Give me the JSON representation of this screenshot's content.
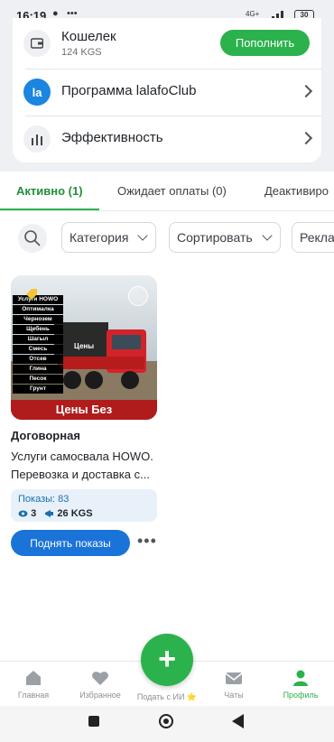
{
  "status_bar": {
    "time": "16:19",
    "network": "4G+",
    "battery": "30"
  },
  "menu": {
    "wallet": {
      "title": "Кошелек",
      "balance": "124 KGS",
      "topup_label": "Пополнить"
    },
    "club": {
      "title": "Программа lalafoClub"
    },
    "efficiency": {
      "title": "Эффективность"
    }
  },
  "tabs": [
    {
      "label": "Активно (1)",
      "active": true
    },
    {
      "label": "Ожидает оплаты (0)",
      "active": false
    },
    {
      "label": "Деактивиро",
      "active": false
    }
  ],
  "filters": {
    "category": "Категория",
    "sort": "Сортировать",
    "ads": "Рекла"
  },
  "listing": {
    "image_text": {
      "services": [
        "Услуги HOWO",
        "Оптималка",
        "Чернозем",
        "Щебень",
        "Шагыл",
        "Смесь",
        "Отсев",
        "Глина",
        "Песок",
        "Грунт"
      ],
      "truck_label": "Цены",
      "banner": "Цены Без посредников!!!"
    },
    "price": "Договорная",
    "title": "Услуги самосвала HOWO. Перевозка и доставка с...",
    "views_label": "Показы: 83",
    "views_count": "3",
    "boost_cost": "26 KGS",
    "boost_button": "Поднять показы"
  },
  "bottom_nav": [
    {
      "label": "Главная",
      "icon": "home-icon"
    },
    {
      "label": "Избранное",
      "icon": "heart-icon"
    },
    {
      "label": "Подать с ИИ ⭐",
      "icon": "plus-icon"
    },
    {
      "label": "Чаты",
      "icon": "mail-icon"
    },
    {
      "label": "Профиль",
      "icon": "user-icon",
      "active": true
    }
  ],
  "colors": {
    "accent_green": "#2bb24c",
    "accent_blue": "#1a73d9",
    "banner_red": "#b01c1c"
  }
}
